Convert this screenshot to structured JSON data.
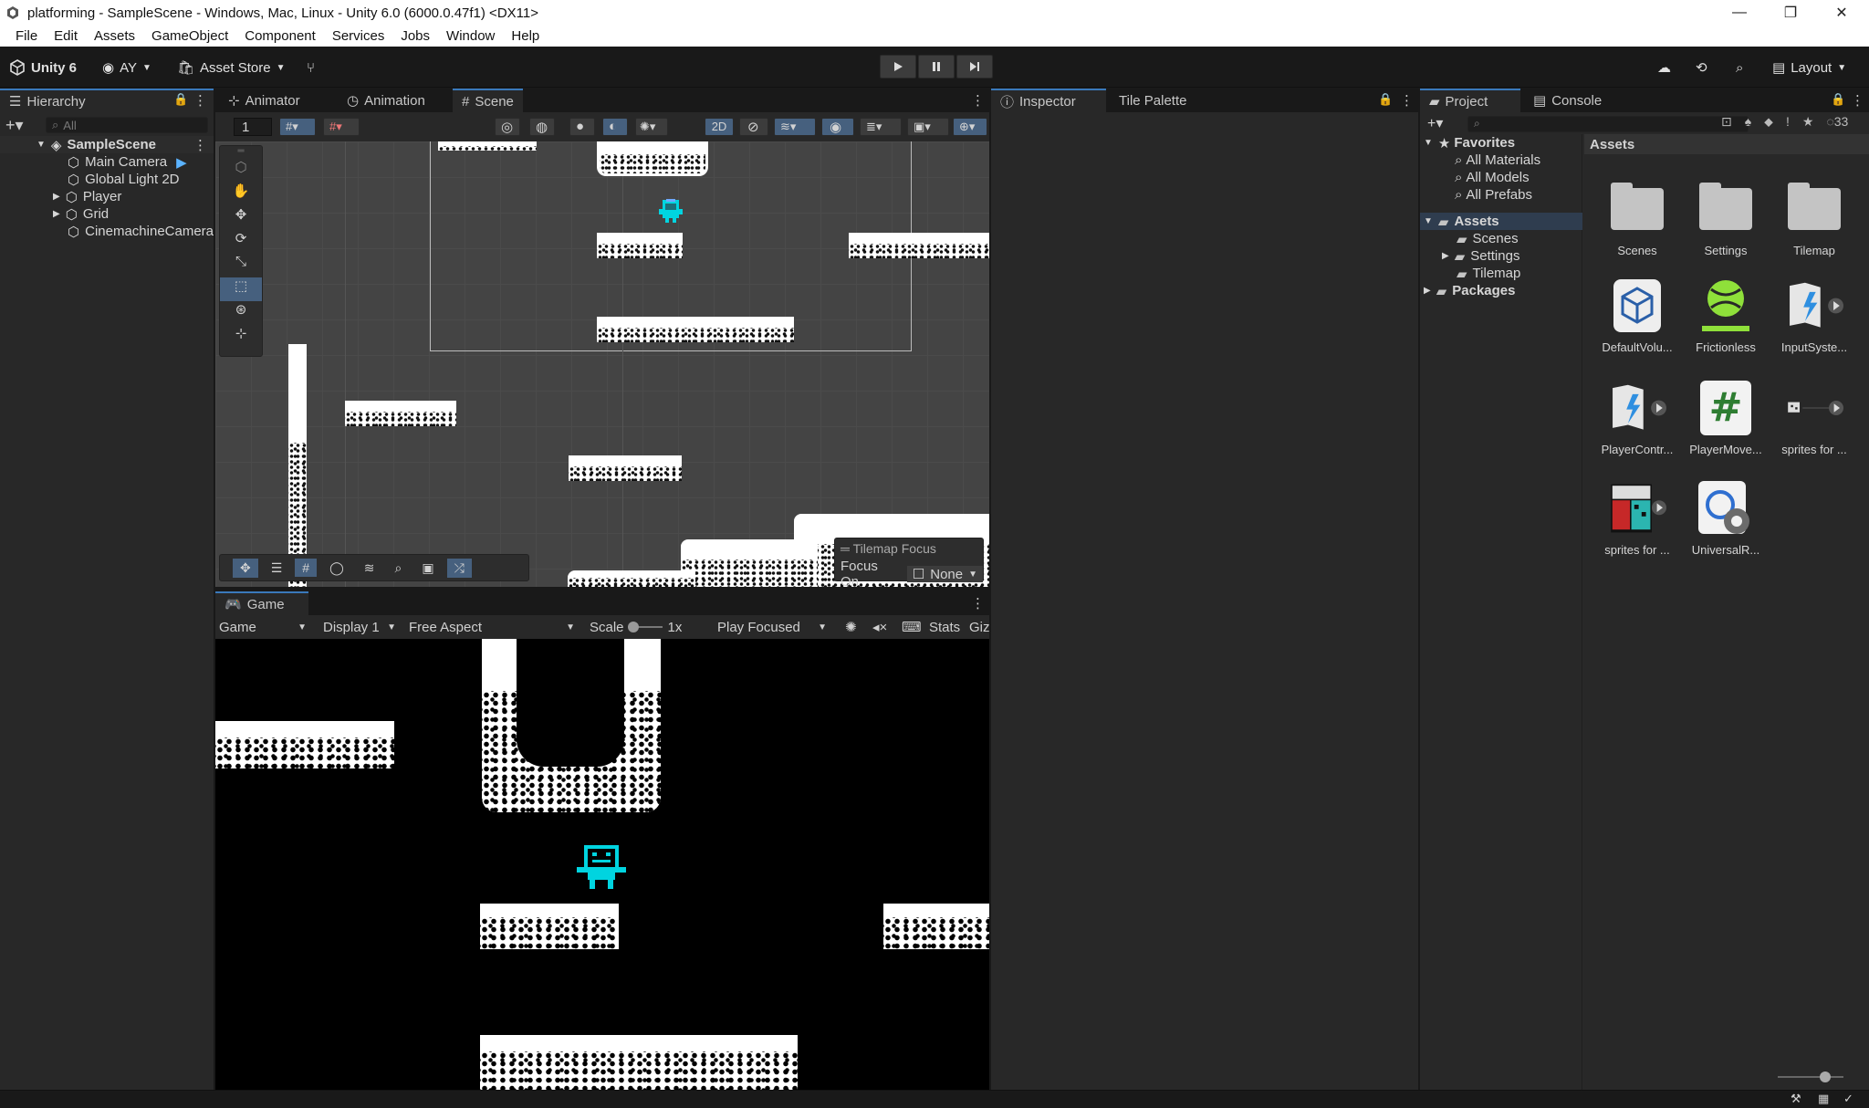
{
  "window": {
    "title": "platforming - SampleScene - Windows, Mac, Linux - Unity 6.0 (6000.0.47f1) <DX11>",
    "minimize": "—",
    "maximize": "❐",
    "close": "✕"
  },
  "menu": [
    "File",
    "Edit",
    "Assets",
    "GameObject",
    "Component",
    "Services",
    "Jobs",
    "Window",
    "Help"
  ],
  "toolbar": {
    "brand": "Unity 6",
    "account": "AY",
    "asset_store": "Asset Store",
    "layout": "Layout"
  },
  "hierarchy": {
    "tab": "Hierarchy",
    "search_placeholder": "All",
    "scene": "SampleScene",
    "items": [
      "Main Camera",
      "Global Light 2D",
      "Player",
      "Grid",
      "CinemachineCamera"
    ]
  },
  "center_tabs": {
    "animator": "Animator",
    "animation": "Animation",
    "scene": "Scene"
  },
  "scene_toolbar": {
    "layer_value": "1",
    "mode_2d": "2D"
  },
  "tilemap_focus": {
    "title": "Tilemap Focus",
    "label": "Focus On",
    "value": "None"
  },
  "game": {
    "tab": "Game",
    "mode": "Game",
    "display": "Display 1",
    "aspect": "Free Aspect",
    "scale_label": "Scale",
    "scale_value": "1x",
    "play_focused": "Play Focused",
    "stats": "Stats",
    "gizmos": "Giz"
  },
  "inspector": {
    "tab": "Inspector",
    "tile_palette": "Tile Palette"
  },
  "project": {
    "tab": "Project",
    "console_tab": "Console",
    "hidden_count": "33",
    "favorites": "Favorites",
    "favorite_items": [
      "All Materials",
      "All Models",
      "All Prefabs"
    ],
    "assets_root": "Assets",
    "asset_folders": [
      "Scenes",
      "Settings",
      "Tilemap"
    ],
    "packages": "Packages",
    "breadcrumb": "Assets",
    "grid": [
      {
        "label": "Scenes",
        "icon": "folder-icon"
      },
      {
        "label": "Settings",
        "icon": "folder-icon"
      },
      {
        "label": "Tilemap",
        "icon": "folder-icon"
      },
      {
        "label": "DefaultVolu...",
        "icon": "volume-profile-icon"
      },
      {
        "label": "Frictionless",
        "icon": "physics-material-icon"
      },
      {
        "label": "InputSyste...",
        "icon": "input-actions-icon"
      },
      {
        "label": "PlayerContr...",
        "icon": "input-actions-icon"
      },
      {
        "label": "PlayerMove...",
        "icon": "csharp-script-icon"
      },
      {
        "label": "sprites for ...",
        "icon": "sprite-icon"
      },
      {
        "label": "sprites for ...",
        "icon": "spritesheet-icon"
      },
      {
        "label": "UniversalR...",
        "icon": "render-pipeline-asset-icon"
      }
    ]
  },
  "colors": {
    "accent": "#3a79bb",
    "panel": "#282828",
    "background": "#191919",
    "player_cyan": "#00d4e0",
    "frictionless_green": "#8fe03a"
  }
}
